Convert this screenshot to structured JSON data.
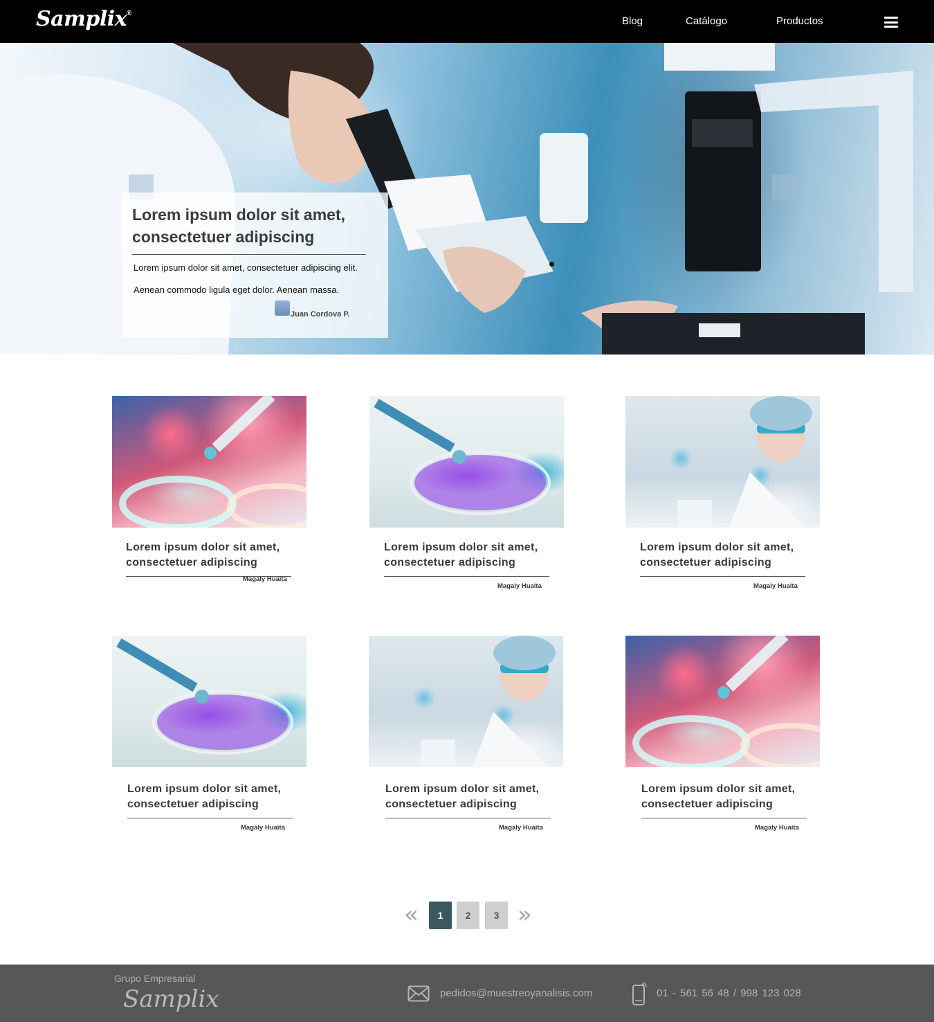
{
  "header": {
    "logo": "Samplix",
    "logo_mark": "®",
    "nav": [
      "Blog",
      "Catálogo",
      "Productos"
    ],
    "menu_icon": "hamburger-menu-icon"
  },
  "hero": {
    "title": "Lorem ipsum dolor sit amet, consectetuer adipiscing",
    "line1": "Lorem ipsum dolor sit amet, consectetuer adipiscing elit.",
    "line2": "Aenean commodo ligula eget dolor. Aenean massa.",
    "author": "Juan Cordova P."
  },
  "cards": [
    {
      "title": "Lorem ipsum dolor sit amet, consectetuer adipiscing",
      "author": "Magaly Huaita"
    },
    {
      "title": "Lorem ipsum dolor sit amet, consectetuer adipiscing",
      "author": "Magaly Huaita"
    },
    {
      "title": "Lorem ipsum dolor sit amet, consectetuer adipiscing",
      "author": "Magaly Huaita"
    },
    {
      "title": "Lorem ipsum dolor sit amet, consectetuer adipiscing",
      "author": "Magaly Huaita"
    },
    {
      "title": "Lorem ipsum dolor sit amet, consectetuer adipiscing",
      "author": "Magaly Huaita"
    },
    {
      "title": "Lorem ipsum dolor sit amet, consectetuer adipiscing",
      "author": "Magaly Huaita"
    }
  ],
  "pagination": {
    "prev": "«",
    "pages": [
      "1",
      "2",
      "3"
    ],
    "active": "1",
    "next": "»"
  },
  "footer": {
    "group": "Grupo Empresarial",
    "logo": "Samplix",
    "email": "pedidos@muestreoyanalisis.com",
    "phones": "01 - 561 56 48   /   998 123 028"
  },
  "colors": {
    "header_bg": "#000000",
    "active_page": "#3b5861",
    "footer_bg": "#575757"
  }
}
